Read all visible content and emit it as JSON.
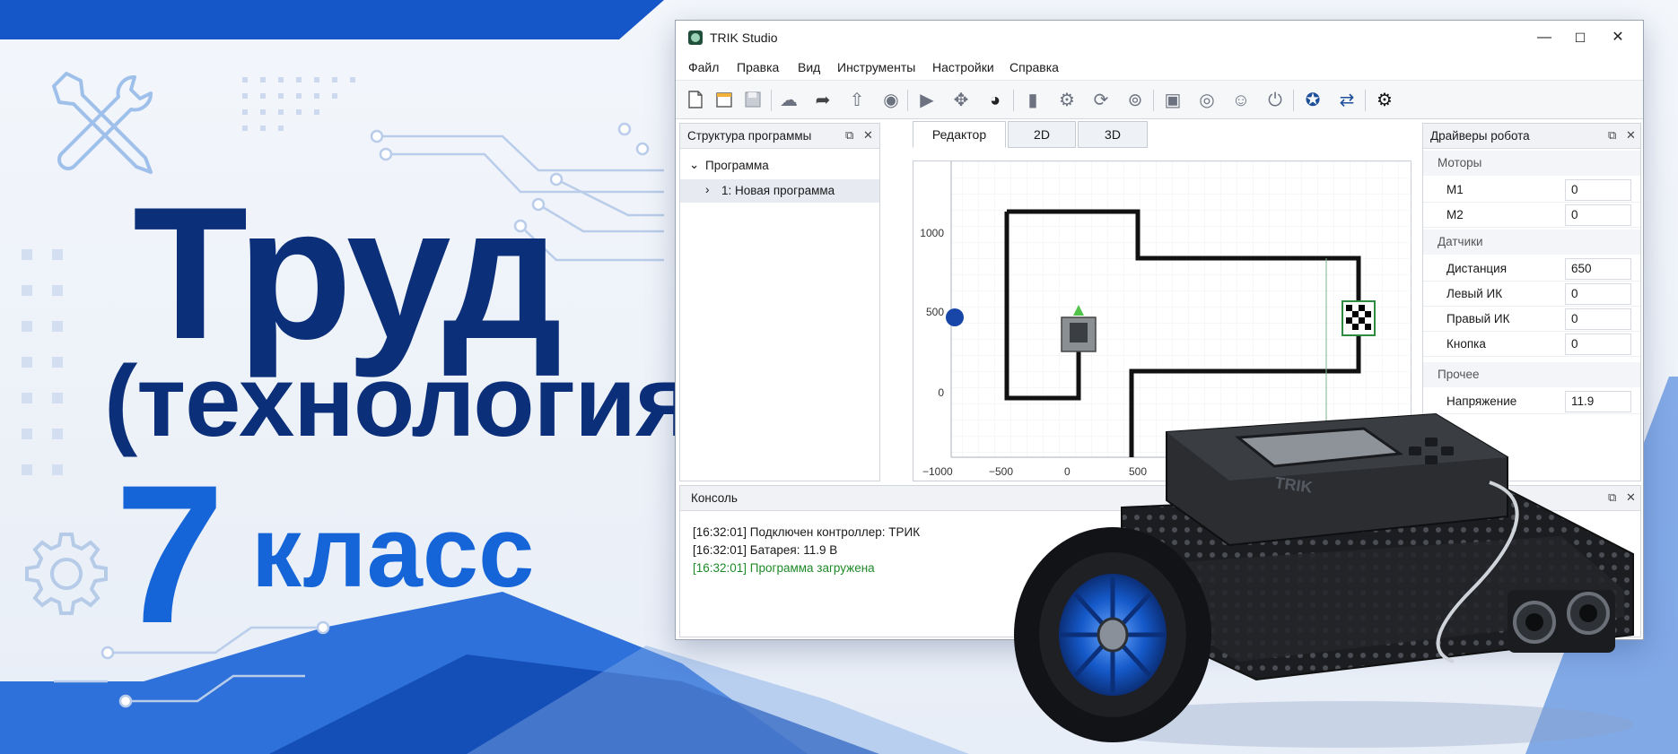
{
  "hero": {
    "title": "Труд",
    "subtitle": "(технология)",
    "grade_number": "7",
    "grade_label": "класс"
  },
  "window": {
    "title": "TRIK Studio",
    "controls": {
      "minimize": "—",
      "maximize": "☐",
      "close": "✕"
    },
    "menu": [
      "Файл",
      "Правка",
      "Вид",
      "Инструменты",
      "Настройки",
      "Справка"
    ],
    "toolbar_icons": [
      "new-file-icon",
      "new-diagram-icon",
      "save-icon",
      "upload-icon",
      "redo-icon",
      "connect-icon",
      "eye-icon",
      "run-icon",
      "robot-arrow-icon",
      "robot-control-icon",
      "panel-icon",
      "gear-icon",
      "refresh-icon",
      "reset-icon",
      "image-icon",
      "target-icon",
      "target2-icon",
      "shutdown-icon",
      "trik-icon",
      "sync-icon",
      "settings-active-icon"
    ]
  },
  "left_dock": {
    "title": "Структура программы",
    "tree": [
      {
        "label": "Программа",
        "arrow": "⌄"
      },
      {
        "label": "1: Новая программа",
        "arrow": "›"
      }
    ]
  },
  "center": {
    "tabs": [
      "Редактор",
      "2D",
      "3D"
    ],
    "active_tab": 0,
    "x_axis_ticks": [
      "−1000",
      "−500",
      "0",
      "500"
    ],
    "y_axis_ticks": [
      "1000",
      "500",
      "0"
    ]
  },
  "right_dock": {
    "title": "Драйверы робота",
    "sections": [
      {
        "name": "Моторы",
        "rows": [
          {
            "label": "M1",
            "value": "0"
          },
          {
            "label": "M2",
            "value": "0"
          }
        ]
      },
      {
        "name": "Датчики",
        "rows": [
          {
            "label": "Дистанция",
            "value": "650"
          },
          {
            "label": "Левый ИК",
            "value": "0"
          },
          {
            "label": "Правый ИК",
            "value": "0"
          },
          {
            "label": "Кнопка",
            "value": "0"
          }
        ]
      },
      {
        "name": "Прочее",
        "rows": [
          {
            "label": "Напряжение",
            "value": "11.9"
          }
        ]
      }
    ]
  },
  "console": {
    "title": "Консоль",
    "lines": [
      {
        "text": "[16:32:01] Подключен контроллер: ТРИК",
        "color": "#1a1a1a"
      },
      {
        "text": "[16:32:01] Батарея: 11.9 В",
        "color": "#1a1a1a"
      },
      {
        "text": "[16:32:01] Программа загружена",
        "color": "#1f8a2a"
      }
    ]
  },
  "robot": {
    "screen_brand": "TRIK"
  },
  "colors": {
    "title_dark": "#0c2f7a",
    "accent_blue": "#1565d8",
    "success_green": "#1f8a2a"
  }
}
